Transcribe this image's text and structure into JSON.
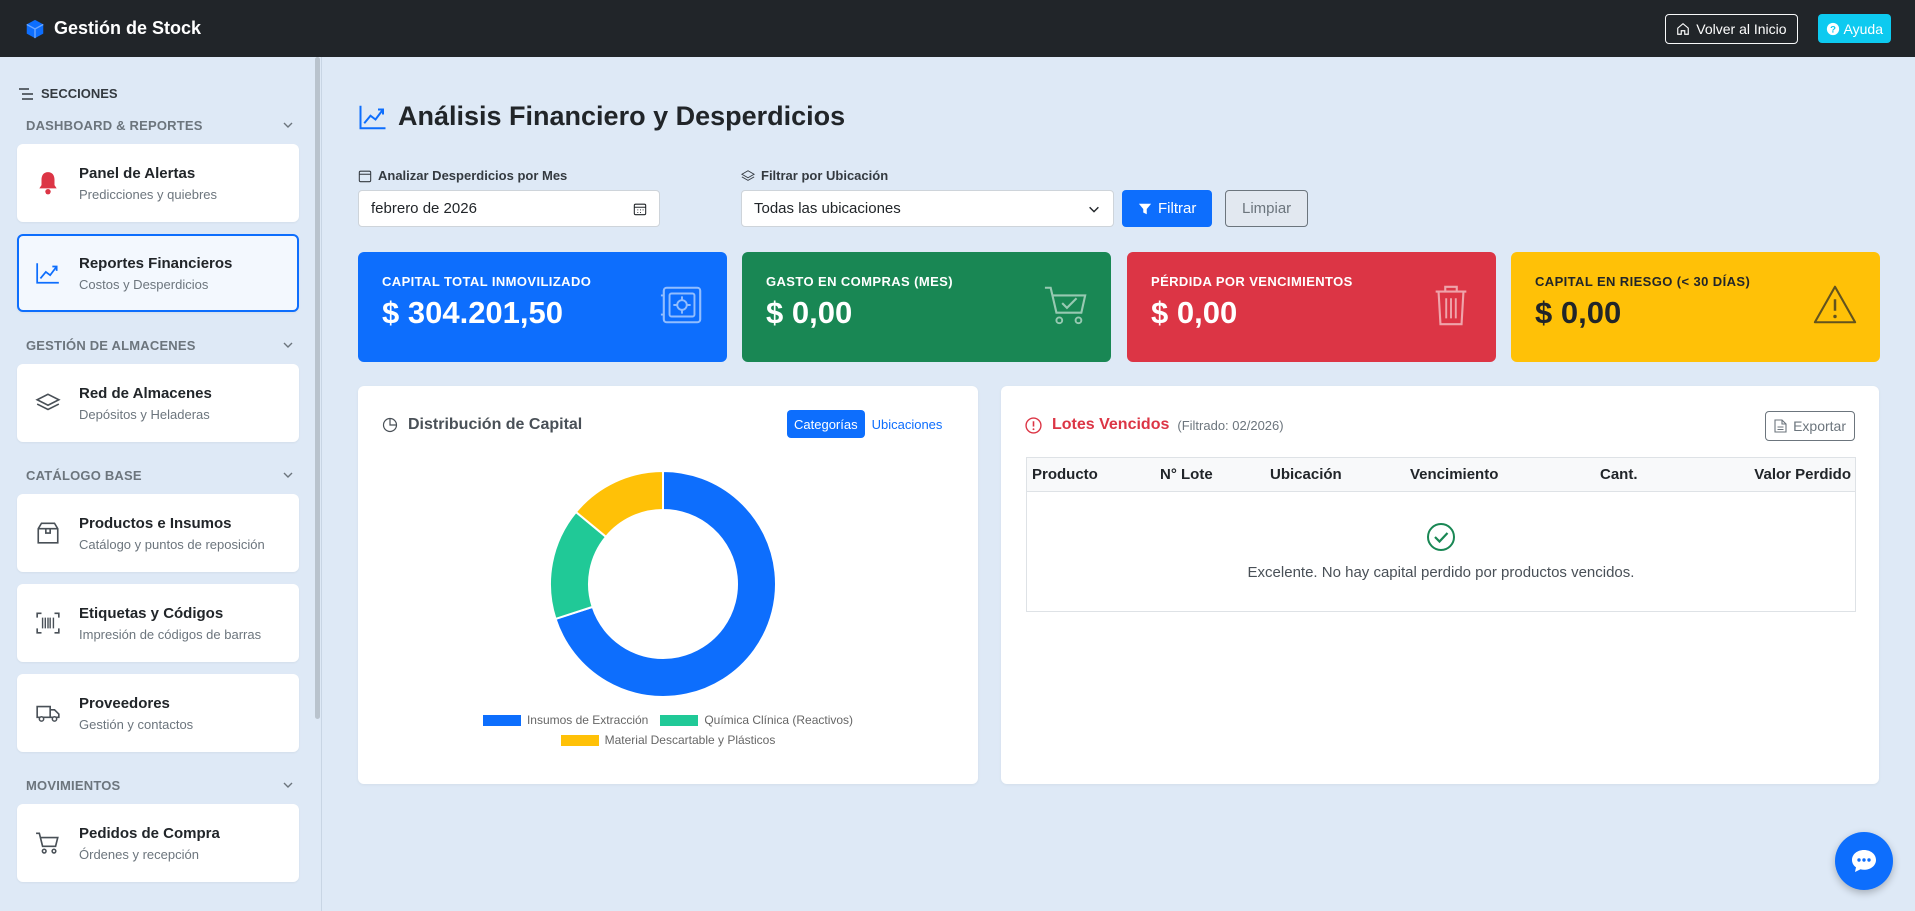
{
  "app": {
    "title": "Gestión de Stock"
  },
  "navbar": {
    "home_label": "Volver al Inicio",
    "help_label": "Ayuda"
  },
  "sidebar": {
    "header": "SECCIONES",
    "groups": [
      {
        "title": "DASHBOARD & REPORTES",
        "items": [
          {
            "title": "Panel de Alertas",
            "subtitle": "Predicciones y quiebres",
            "icon": "bell-icon"
          },
          {
            "title": "Reportes Financieros",
            "subtitle": "Costos y Desperdicios",
            "icon": "chart-line-icon",
            "active": true
          }
        ]
      },
      {
        "title": "GESTIÓN DE ALMACENES",
        "items": [
          {
            "title": "Red de Almacenes",
            "subtitle": "Depósitos y Heladeras",
            "icon": "layers-icon"
          }
        ]
      },
      {
        "title": "CATÁLOGO BASE",
        "items": [
          {
            "title": "Productos e Insumos",
            "subtitle": "Catálogo y puntos de reposición",
            "icon": "box-icon"
          },
          {
            "title": "Etiquetas y Códigos",
            "subtitle": "Impresión de códigos de barras",
            "icon": "barcode-icon"
          },
          {
            "title": "Proveedores",
            "subtitle": "Gestión y contactos",
            "icon": "truck-icon"
          }
        ]
      },
      {
        "title": "MOVIMIENTOS",
        "items": [
          {
            "title": "Pedidos de Compra",
            "subtitle": "Órdenes y recepción",
            "icon": "cart-icon"
          }
        ]
      }
    ]
  },
  "main": {
    "title": "Análisis Financiero y Desperdicios",
    "filters": {
      "month_label": "Analizar Desperdicios por Mes",
      "month_value": "febrero de 2026",
      "location_label": "Filtrar por Ubicación",
      "location_value": "Todas las ubicaciones",
      "filter_button": "Filtrar",
      "clear_button": "Limpiar"
    },
    "kpis": [
      {
        "label": "CAPITAL TOTAL INMOVILIZADO",
        "value": "$ 304.201,50",
        "color": "#0d6efd",
        "icon": "safe-icon"
      },
      {
        "label": "GASTO EN COMPRAS (MES)",
        "value": "$ 0,00",
        "color": "#198754",
        "icon": "cart-check-icon"
      },
      {
        "label": "PÉRDIDA POR VENCIMIENTOS",
        "value": "$ 0,00",
        "color": "#dc3545",
        "icon": "trash-icon"
      },
      {
        "label": "CAPITAL EN RIESGO (< 30 DÍAS)",
        "value": "$ 0,00",
        "color": "#ffc107",
        "icon": "warning-icon"
      }
    ],
    "distribution": {
      "title": "Distribución de Capital",
      "tabs": [
        "Categorías",
        "Ubicaciones"
      ],
      "active_tab": "Categorías"
    },
    "expired": {
      "title": "Lotes Vencidos",
      "filter_note": "(Filtrado: 02/2026)",
      "export_label": "Exportar",
      "columns": [
        "Producto",
        "N° Lote",
        "Ubicación",
        "Vencimiento",
        "Cant.",
        "Valor Perdido"
      ],
      "empty_message": "Excelente. No hay capital perdido por productos vencidos."
    }
  },
  "chart_data": {
    "type": "pie",
    "categories": [
      "Insumos de Extracción",
      "Química Clínica (Reactivos)",
      "Material Descartable y Plásticos"
    ],
    "values": [
      0.7,
      0.16,
      0.14
    ],
    "colors": [
      "#0d6efd",
      "#20c997",
      "#ffc107"
    ],
    "legend": "bottom"
  }
}
